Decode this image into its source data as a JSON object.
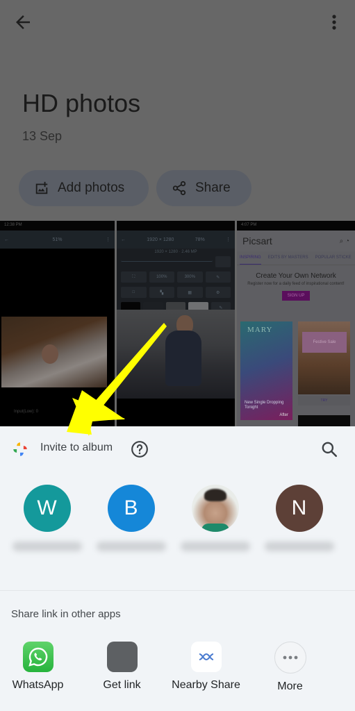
{
  "album": {
    "title": "HD photos",
    "date": "13 Sep",
    "actions": {
      "add_photos": "Add photos",
      "share": "Share"
    },
    "icons": {
      "back": "arrow-left-icon",
      "menu": "more-vert-icon",
      "add_photos": "add-photo-icon",
      "share": "share-icon"
    },
    "thumbnails": [
      {
        "status_time": "12:38 PM",
        "toolbar_zoom": "51%",
        "caption": "Input(Low): 0",
        "subject": "woman lying on autumn leaves"
      },
      {
        "toolbar_size": "1920 × 1280",
        "toolbar_zoom": "78%",
        "info": "1920 × 1280 · 2.46 MP",
        "buttons": [
          "100%",
          "300%"
        ],
        "subject": "man sitting on sofa"
      },
      {
        "status_time": "4:07 PM",
        "app_name": "Picsart",
        "tabs": [
          "INSPIRING",
          "EDITS BY MASTERS",
          "POPULAR STICKE"
        ],
        "cta_heading": "Create Your Own Network",
        "cta_sub": "Register now for a daily feed of inspirational content!",
        "cta_button": "SIGN UP",
        "card1_title": "MARY",
        "card1_text": "New Single Dropping Tonight",
        "card1_after": "After",
        "card2_label": "Festive Sale",
        "card2_try": "TRY"
      }
    ]
  },
  "sheet": {
    "header": {
      "label": "Invite to album",
      "icons": {
        "logo": "google-photos-logo-icon",
        "help": "help-circle-icon",
        "search": "search-icon"
      }
    },
    "contacts": [
      {
        "initial": "W",
        "color": "#14999b",
        "name": "(blurred)"
      },
      {
        "initial": "B",
        "color": "#1587d8",
        "name": "(blurred)"
      },
      {
        "initial": "",
        "color": "#e9ece9",
        "name": "(blurred)",
        "photo": true
      },
      {
        "initial": "N",
        "color": "#5d4037",
        "name": "(blurred)"
      }
    ],
    "other_apps_label": "Share link in other apps",
    "apps": [
      {
        "label": "WhatsApp",
        "icon": "whatsapp-icon"
      },
      {
        "label": "Get link",
        "icon": "link-icon"
      },
      {
        "label": "Nearby Share",
        "icon": "nearby-share-icon"
      },
      {
        "label": "More",
        "icon": "more-horiz-icon"
      }
    ]
  },
  "annotation": {
    "type": "arrow",
    "color": "#ffff00",
    "points_to": "Invite to album"
  }
}
